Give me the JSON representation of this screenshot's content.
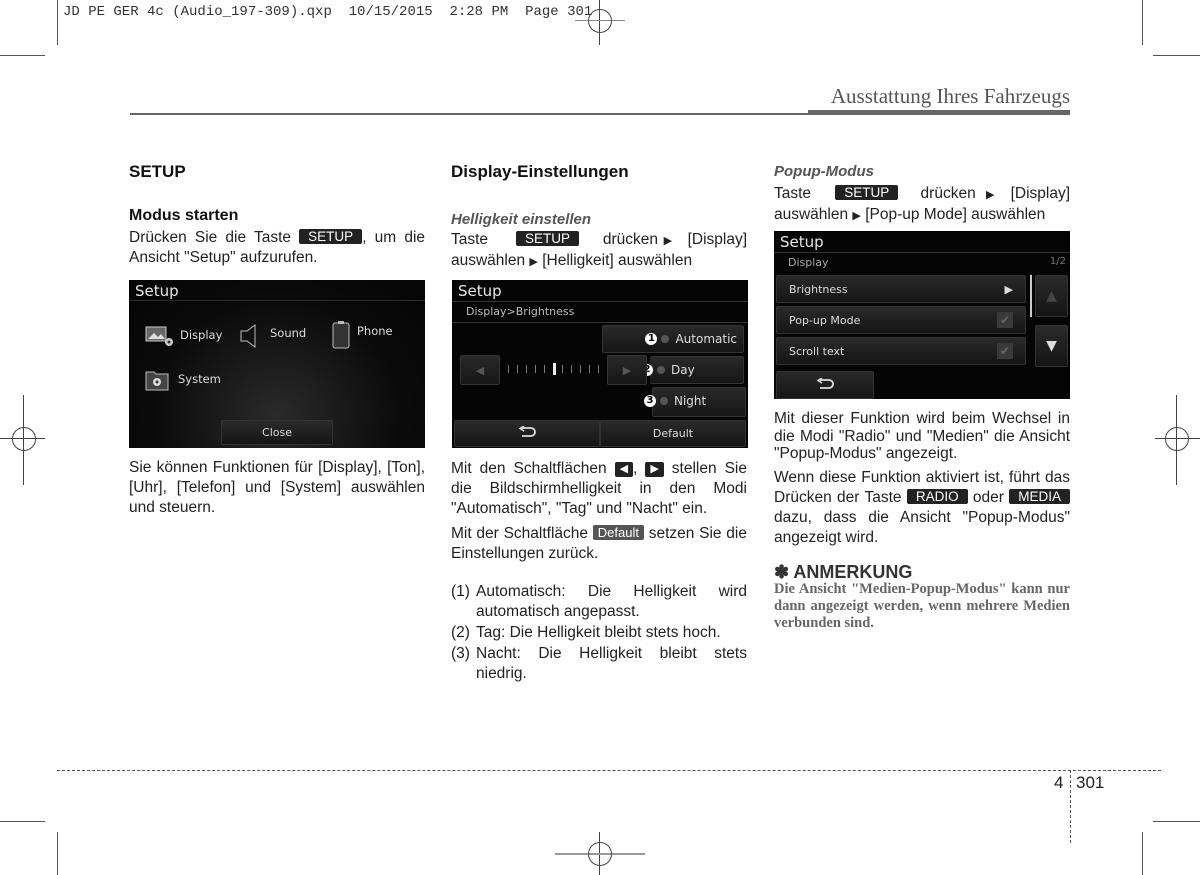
{
  "slug": "JD PE GER 4c (Audio_197-309).qxp  10/15/2015  2:28 PM  Page 301",
  "chapter_title": "Ausstattung Ihres Fahrzeugs",
  "col1": {
    "title": "SETUP",
    "subtitle": "Modus starten",
    "p1_before": "Drücken Sie die Taste ",
    "p1_key": "SETUP",
    "p1_after": ", um die Ansicht \"Setup\" aufzurufen.",
    "screen": {
      "title": "Setup",
      "items": [
        {
          "label": "Display",
          "icon": "display-settings-icon"
        },
        {
          "label": "Sound",
          "icon": "speaker-icon"
        },
        {
          "label": "Phone",
          "icon": "phone-icon"
        },
        {
          "label": "System",
          "icon": "system-folder-icon"
        }
      ],
      "close_label": "Close"
    },
    "p2": "Sie können Funktionen für [Display], [Ton], [Uhr], [Telefon] und [System] auswählen und steuern."
  },
  "col2": {
    "title": "Display-Einstellungen",
    "subtitle": "Helligkeit einstellen",
    "p1_a": "Taste ",
    "p1_key": "SETUP",
    "p1_b": " drücken",
    "p1_c": " [Display] auswählen ",
    "p1_d": " [Helligkeit] auswählen",
    "screen": {
      "title": "Setup",
      "breadcrumb": "Display>Brightness",
      "options": [
        {
          "num": "1",
          "label": "Automatic"
        },
        {
          "num": "2",
          "label": "Day"
        },
        {
          "num": "3",
          "label": "Night"
        }
      ],
      "slider_level": 0.5,
      "back_icon": "back-arrow-icon",
      "default_label": "Default"
    },
    "p2_a": "Mit den Schaltflächen ",
    "p2_key_left": "◀",
    "p2_sep": ", ",
    "p2_key_right": "▶",
    "p2_b": " stellen Sie die Bildschirmhelligkeit in den Modi \"Automatisch\", \"Tag\" und \"Nacht\" ein.",
    "p3_a": "Mit der Schaltfläche ",
    "p3_key": "Default",
    "p3_b": " setzen Sie die Einstellungen zurück.",
    "list": [
      {
        "num": "(1)",
        "text": "Automatisch: Die Helligkeit wird automatisch angepasst."
      },
      {
        "num": "(2)",
        "text": "Tag: Die Helligkeit bleibt stets hoch."
      },
      {
        "num": "(3)",
        "text": "Nacht: Die Helligkeit bleibt stets niedrig."
      }
    ]
  },
  "col3": {
    "subtitle": "Popup-Modus",
    "p1_a": "Taste ",
    "p1_key": "SETUP",
    "p1_b": " drücken ",
    "p1_c": " [Display] auswählen ",
    "p1_d": " [Pop-up Mode] auswählen",
    "screen": {
      "title": "Setup",
      "section": "Display",
      "page": "1/2",
      "rows": [
        {
          "label": "Brightness",
          "control": "arrow"
        },
        {
          "label": "Pop-up Mode",
          "control": "check"
        },
        {
          "label": "Scroll text",
          "control": "check"
        }
      ],
      "back_icon": "back-arrow-icon"
    },
    "p2": "Mit dieser Funktion wird beim Wechsel in die Modi \"Radio\" und \"Medien\" die Ansicht \"Popup-Modus\" angezeigt.",
    "p3_a": "Wenn diese Funktion aktiviert ist, führt das Drücken der Taste ",
    "p3_key1": "RADIO",
    "p3_b": " oder ",
    "p3_key2": "MEDIA",
    "p3_c": " dazu, dass die Ansicht \"Popup-Modus\" angezeigt wird.",
    "note_title": "✽ ANMERKUNG",
    "note_text": "Die Ansicht \"Medien-Popup-Modus\" kann nur dann angezeigt werden, wenn mehrere Medien verbunden sind."
  },
  "footer": {
    "chapter_num": "4",
    "page_num": "301"
  }
}
